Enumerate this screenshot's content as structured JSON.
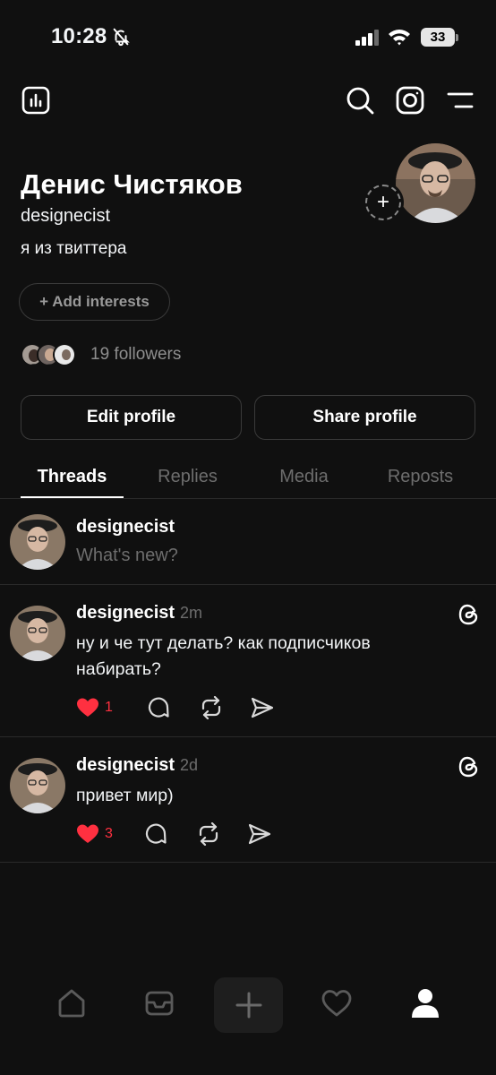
{
  "status": {
    "time": "10:28",
    "battery": "33"
  },
  "profile": {
    "name": "Денис Чистяков",
    "handle": "designecist",
    "bio": "я из твиттера",
    "add_interests_label": "+ Add interests",
    "followers_text": "19 followers",
    "edit_label": "Edit profile",
    "share_label": "Share profile"
  },
  "tabs": [
    {
      "label": "Threads",
      "active": true
    },
    {
      "label": "Replies",
      "active": false
    },
    {
      "label": "Media",
      "active": false
    },
    {
      "label": "Reposts",
      "active": false
    }
  ],
  "composer": {
    "username": "designecist",
    "placeholder": "What's new?"
  },
  "posts": [
    {
      "username": "designecist",
      "time": "2m",
      "text": "ну и че тут делать? как подписчиков набирать?",
      "likes": "1"
    },
    {
      "username": "designecist",
      "time": "2d",
      "text": "привет мир)",
      "likes": "3"
    }
  ],
  "colors": {
    "background": "#101010",
    "like": "#ff3040",
    "muted": "#6d6d6d"
  },
  "icons": {
    "top": [
      "insights-icon",
      "search-icon",
      "instagram-icon",
      "menu-icon"
    ],
    "nav": [
      "home-icon",
      "inbox-icon",
      "plus-icon",
      "heart-icon",
      "profile-icon"
    ],
    "post_actions": [
      "heart-icon",
      "comment-icon",
      "repost-icon",
      "share-icon"
    ]
  }
}
